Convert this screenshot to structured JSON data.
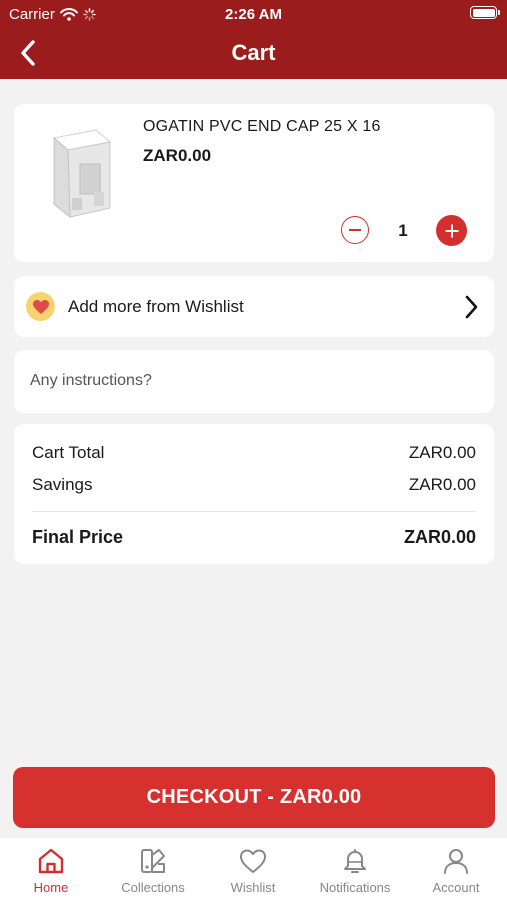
{
  "status_bar": {
    "carrier": "Carrier",
    "time": "2:26 AM"
  },
  "header": {
    "title": "Cart",
    "back_icon": "chevron-left-icon"
  },
  "cart_item": {
    "name": "OGATIN PVC END CAP 25 X 16",
    "price": "ZAR0.00",
    "quantity": "1"
  },
  "wishlist_row": {
    "label": "Add more from Wishlist",
    "icon": "heart-icon"
  },
  "instructions": {
    "placeholder": "Any instructions?",
    "value": ""
  },
  "summary": {
    "cart_total_label": "Cart Total",
    "cart_total_value": "ZAR0.00",
    "savings_label": "Savings",
    "savings_value": "ZAR0.00",
    "final_label": "Final Price",
    "final_value": "ZAR0.00"
  },
  "checkout": {
    "label": "CHECKOUT - ZAR0.00"
  },
  "tabs": [
    {
      "label": "Home",
      "icon": "home-icon",
      "active": true
    },
    {
      "label": "Collections",
      "icon": "collections-icon",
      "active": false
    },
    {
      "label": "Wishlist",
      "icon": "heart-icon",
      "active": false
    },
    {
      "label": "Notifications",
      "icon": "bell-icon",
      "active": false
    },
    {
      "label": "Account",
      "icon": "user-icon",
      "active": false
    }
  ],
  "colors": {
    "header": "#9b1c1c",
    "accent": "#d32f2f",
    "background": "#f2f2f2"
  }
}
